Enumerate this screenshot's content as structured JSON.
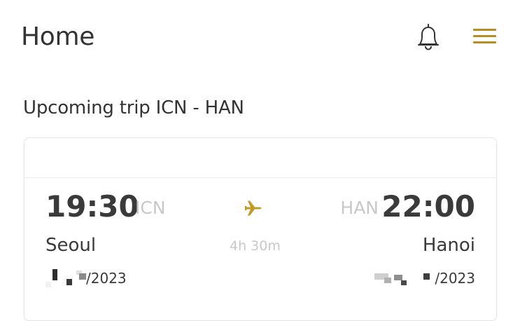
{
  "header": {
    "title": "Home",
    "bell_icon": "bell-icon",
    "menu_icon": "hamburger-menu-icon",
    "accent_color": "#b58e1f"
  },
  "upcoming": {
    "section_title": "Upcoming trip ICN - HAN",
    "card": {
      "departure": {
        "time": "19:30",
        "code": "ICN",
        "city": "Seoul",
        "date_suffix": "/2023"
      },
      "arrival": {
        "time": "22:00",
        "code": "HAN",
        "city": "Hanoi",
        "date_suffix": "/2023"
      },
      "duration": "4h 30m",
      "plane_icon": "airplane-icon"
    }
  }
}
